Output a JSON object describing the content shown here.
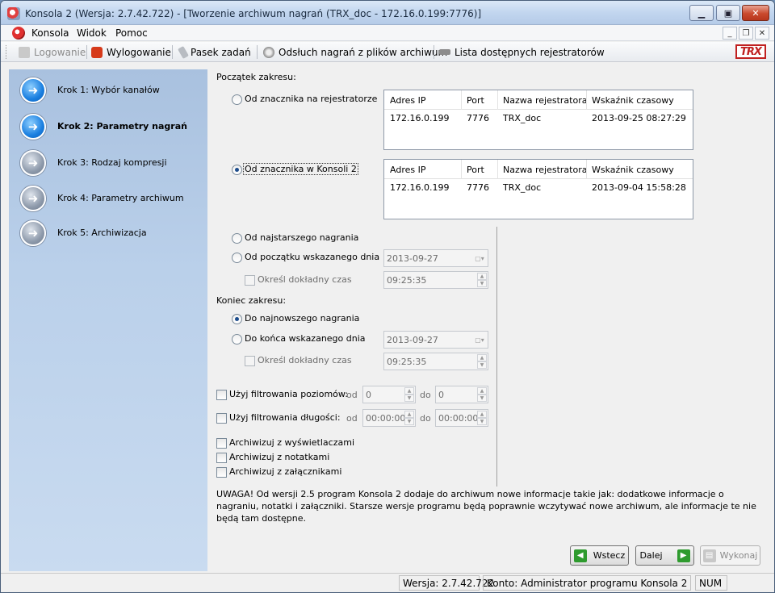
{
  "window": {
    "title": "Konsola 2 (Wersja:  2.7.42.722) - [Tworzenie archiwum nagrań (TRX_doc - 172.16.0.199:7776)]"
  },
  "menu": {
    "items": [
      "Konsola",
      "Widok",
      "Pomoc"
    ]
  },
  "toolbar": {
    "login": "Logowanie",
    "logout": "Wylogowanie",
    "taskbar": "Pasek zadań",
    "playback": "Odsłuch nagrań z plików archiwum",
    "recorders": "Lista dostępnych rejestratorów",
    "logo": "TRX"
  },
  "steps": [
    {
      "label": "Krok 1: Wybór kanałów"
    },
    {
      "label": "Krok 2: Parametry nagrań"
    },
    {
      "label": "Krok 3: Rodzaj kompresji"
    },
    {
      "label": "Krok 4: Parametry archiwum"
    },
    {
      "label": "Krok 5: Archiwizacja"
    }
  ],
  "start": {
    "heading": "Początek zakresu:",
    "opt_recorder": "Od znacznika na rejestratorze",
    "opt_console": "Od znacznika w Konsoli 2",
    "opt_oldest": "Od najstarszego nagrania",
    "opt_day": "Od początku wskazanego dnia",
    "date": "2013-09-27",
    "exact_time": "Określ dokładny czas",
    "time": "09:25:35"
  },
  "grid_columns": [
    "Adres IP",
    "Port",
    "Nazwa rejestratora",
    "Wskaźnik czasowy"
  ],
  "grid1": {
    "ip": "172.16.0.199",
    "port": "7776",
    "name": "TRX_doc",
    "ts": "2013-09-25 08:27:29"
  },
  "grid2": {
    "ip": "172.16.0.199",
    "port": "7776",
    "name": "TRX_doc",
    "ts": "2013-09-04 15:58:28"
  },
  "end": {
    "heading": "Koniec zakresu:",
    "opt_newest": "Do najnowszego nagrania",
    "opt_day": "Do końca wskazanego dnia",
    "date": "2013-09-27",
    "exact_time": "Określ dokładny czas",
    "time": "09:25:35"
  },
  "filters": {
    "level_label": "Użyj filtrowania poziomów:",
    "length_label": "Użyj filtrowania długości:",
    "from": "od",
    "to": "do",
    "level_from": "0",
    "level_to": "0",
    "length_from": "00:00:00",
    "length_to": "00:00:00"
  },
  "archive": {
    "displays": "Archiwizuj z wyświetlaczami",
    "notes": "Archiwizuj z notatkami",
    "attachments": "Archiwizuj z załącznikami"
  },
  "warning": {
    "line1": "UWAGA! Od wersji 2.5 program Konsola 2 dodaje do archiwum nowe informacje takie jak: dodatkowe informacje o",
    "line2": "nagraniu, notatki i załączniki. Starsze wersje programu będą poprawnie wczytywać nowe archiwum, ale informacje te nie",
    "line3": "będą tam dostępne."
  },
  "buttons": {
    "back": "Wstecz",
    "next": "Dalej",
    "execute": "Wykonaj"
  },
  "statusbar": {
    "version": "Wersja: 2.7.42.722",
    "account": "Konto: Administrator programu Konsola 2",
    "num": "NUM"
  },
  "colors": {
    "accent": "#1a7fe0",
    "brand": "#c02020",
    "sidebar": "#bad0ea"
  }
}
